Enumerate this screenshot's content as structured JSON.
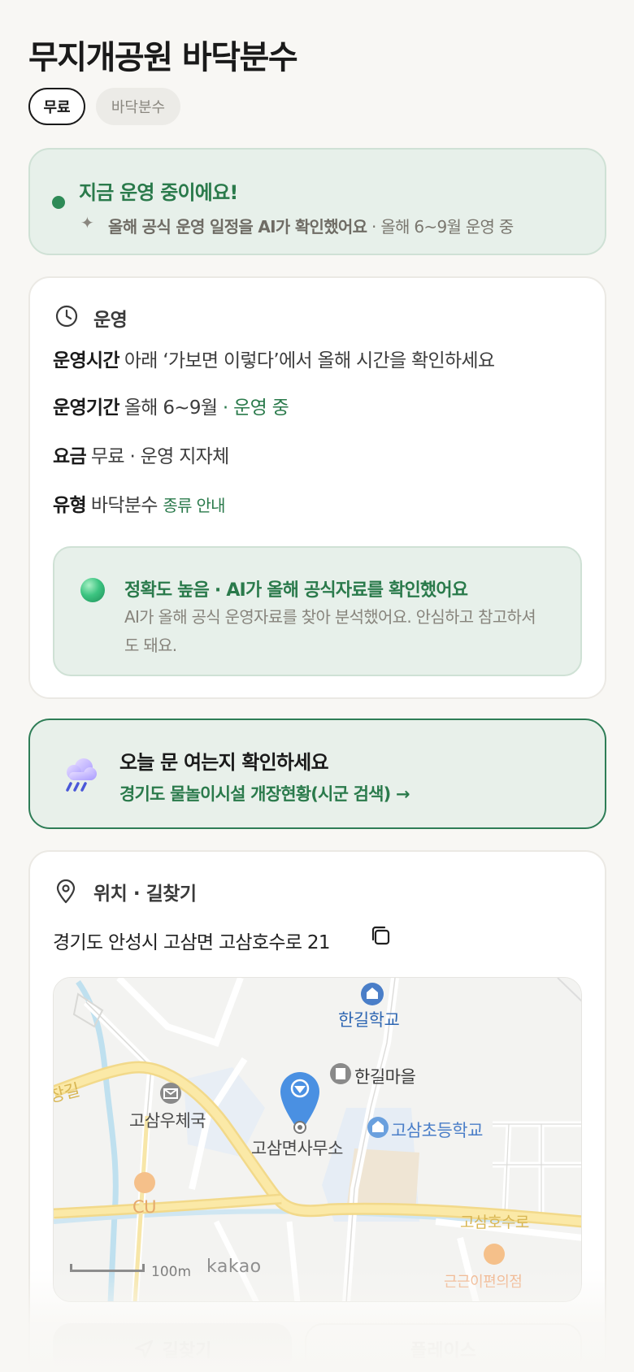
{
  "header": {
    "title": "무지개공원 바닥분수",
    "chips": [
      "무료",
      "바닥분수"
    ]
  },
  "status": {
    "title": "지금 운영 중이에요!",
    "sub_bold": "올해 공식 운영 일정을 AI가 확인했어요",
    "sub_rest": " · 올해 6~9월 운영 중"
  },
  "operation": {
    "section_title": "운영",
    "hours_key": "운영시간",
    "hours_value": "아래 ‘가보면 이렇다’에서 올해 시간을 확인하세요",
    "period_key": "운영기간",
    "period_value": "올해 6~9월",
    "period_status": " · 운영 중",
    "fee_key": "요금",
    "fee_value": "무료 · 운영 지자체",
    "type_key": "유형",
    "type_value": "바닥분수",
    "type_link": "종류 안내",
    "accuracy_title": "정확도 높음 · AI가 올해 공식자료를 확인했어요",
    "accuracy_text": "AI가 올해 공식 운영자료를 찾아 분석했어요. 안심하고 참고하셔도 돼요."
  },
  "check": {
    "title": "오늘 문 여는지 확인하세요",
    "link": "경기도 물놀이시설 개장현황(시군 검색) →"
  },
  "location": {
    "section_title": "위치 · 길찾기",
    "address": "경기도 안성시 고삼면 고삼호수로 21",
    "map": {
      "labels": {
        "school": "한길학교",
        "village": "한길마을",
        "post_office": "고삼우체국",
        "office": "고삼면사무소",
        "elementary": "고삼초등학교",
        "store": "CU",
        "road_west": "창길",
        "road_east": "고삼호수로",
        "cut_bottom": "근근이편의점"
      },
      "scale": "100m",
      "provider": "kakao"
    },
    "buttons": {
      "directions": "길찾기",
      "place": "플레이스"
    }
  },
  "colors": {
    "accent_green": "#2a7a4b",
    "status_bg": "#e7f0ea",
    "map_pin": "#4a90e2"
  }
}
